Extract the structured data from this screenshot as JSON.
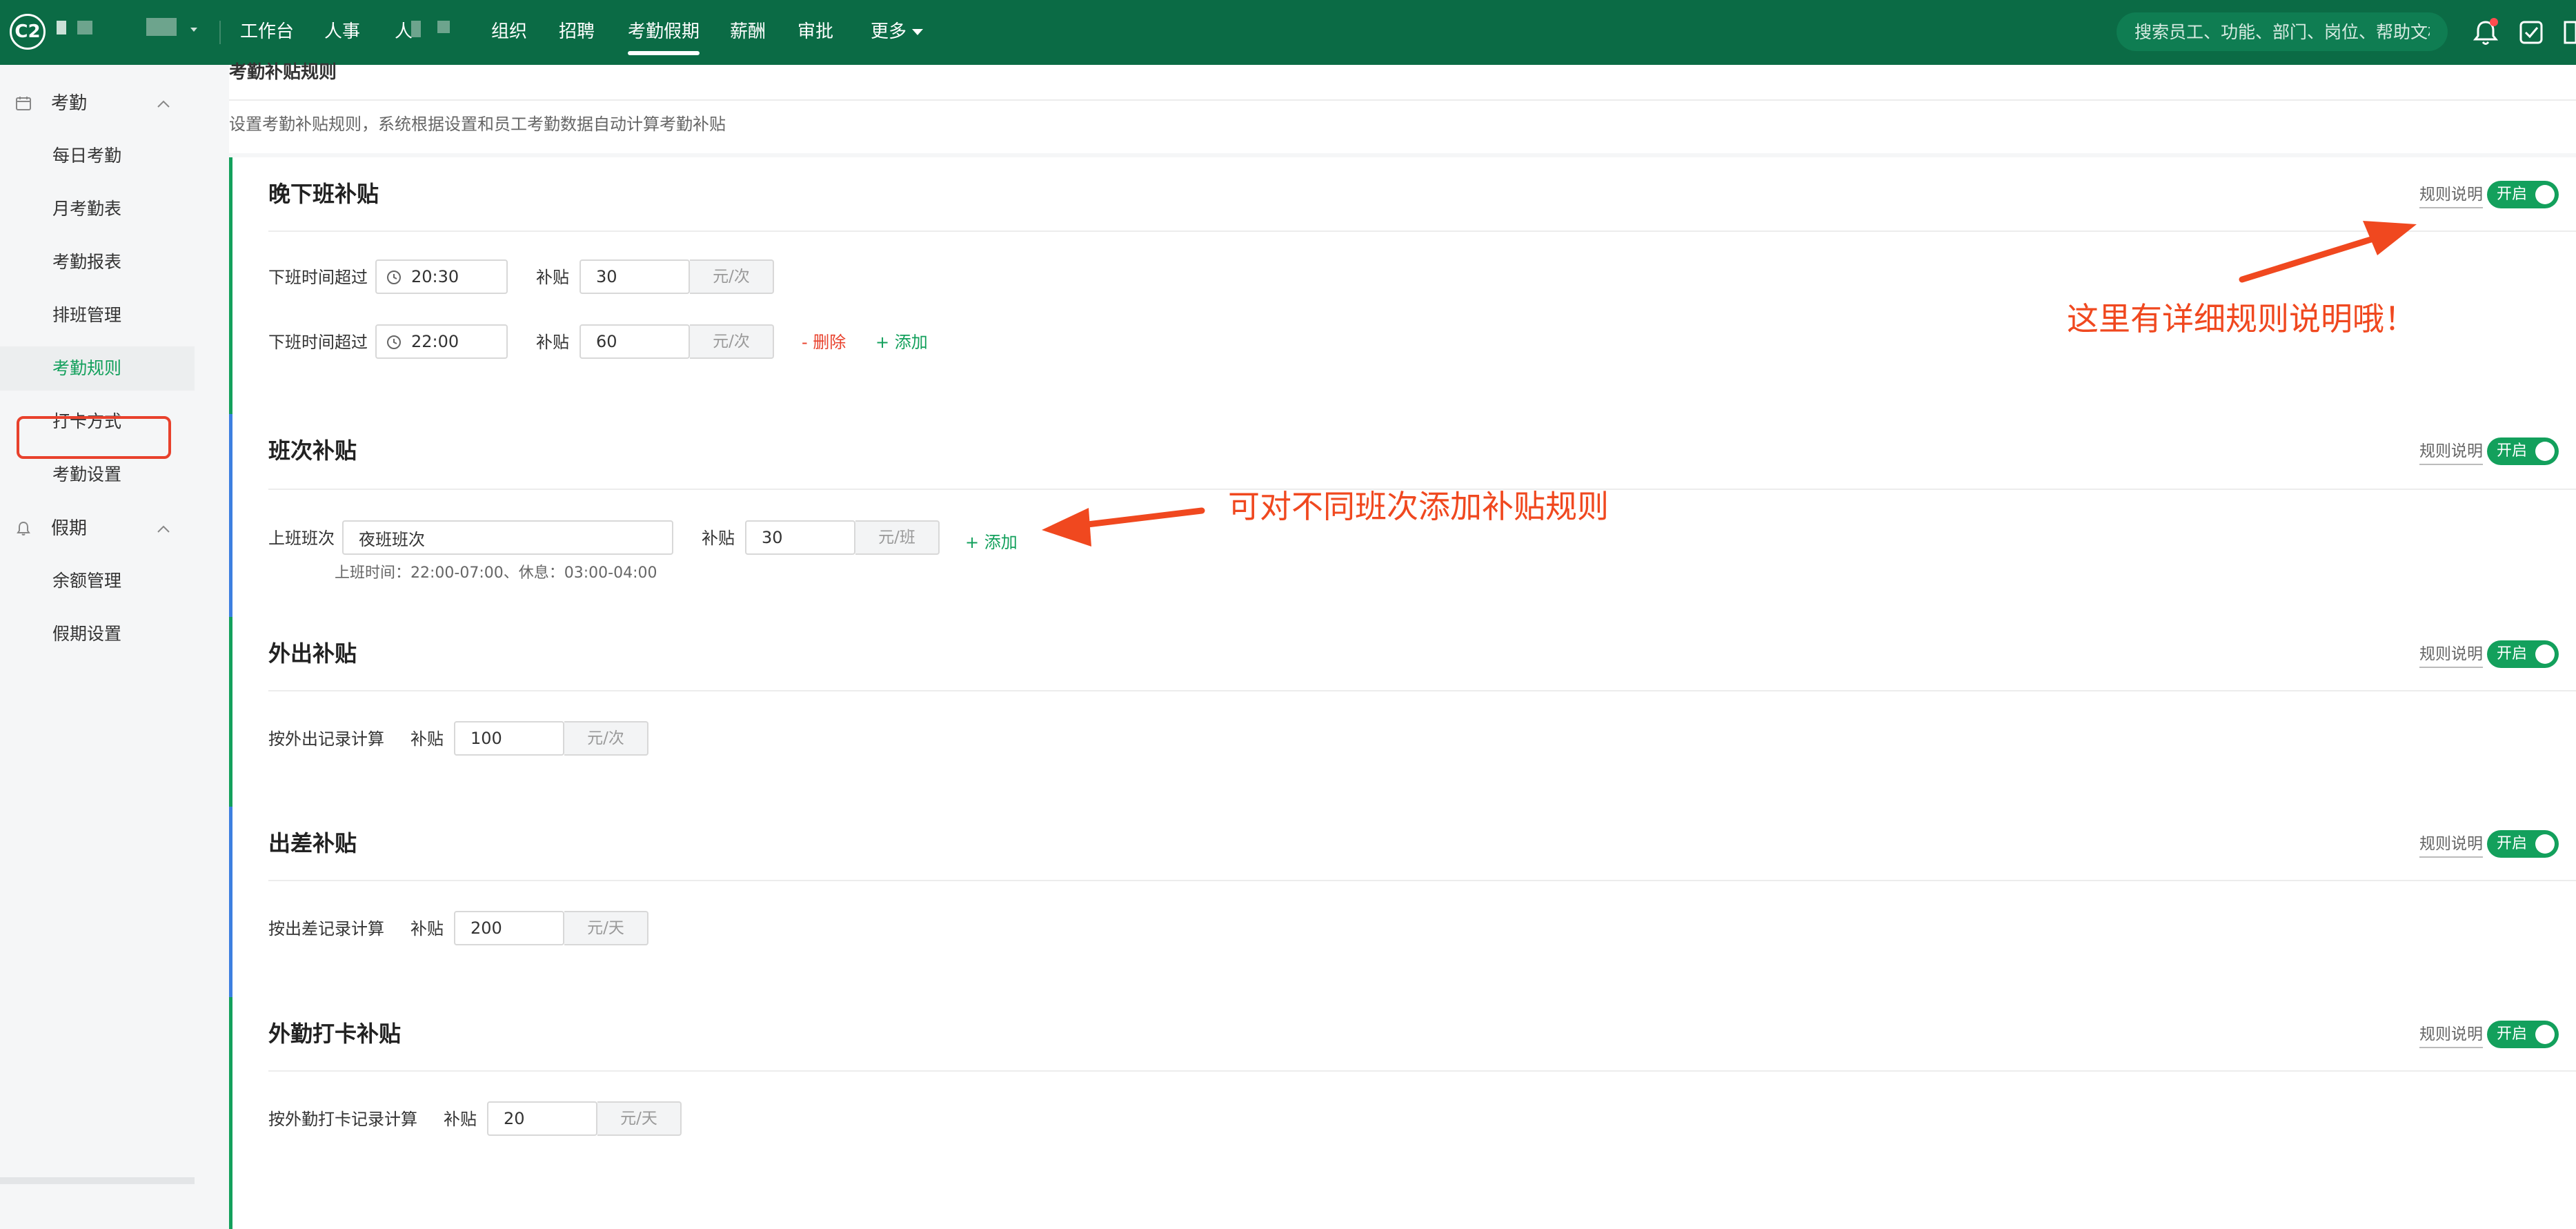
{
  "topbar": {
    "logo_text": "C2",
    "nav": [
      "工作台",
      "人事",
      "人",
      "组织",
      "招聘",
      "考勤假期",
      "薪酬",
      "审批",
      "更多"
    ],
    "active_nav": "考勤假期",
    "search_placeholder": "搜索员工、功能、部门、岗位、帮助文档",
    "notification_badge_color": "#ff4d4f",
    "bg_color": "#0b6b45"
  },
  "sidebar": {
    "groups": [
      {
        "label": "考勤",
        "icon": "calendar-icon",
        "items": [
          "每日考勤",
          "月考勤表",
          "考勤报表",
          "排班管理",
          "考勤规则",
          "打卡方式",
          "考勤设置"
        ]
      },
      {
        "label": "假期",
        "icon": "bell-icon",
        "items": [
          "余额管理",
          "假期设置"
        ]
      }
    ],
    "active_item": "考勤规则"
  },
  "page": {
    "title": "考勤补贴规则",
    "description": "设置考勤补贴规则，系统根据设置和员工考勤数据自动计算考勤补贴"
  },
  "common": {
    "rule_link": "规则说明",
    "toggle_label": "开启",
    "subsidy_label": "补贴",
    "accent_color": "#13a05c"
  },
  "cards": {
    "late_off": {
      "title": "晚下班补贴",
      "rows": [
        {
          "label": "下班时间超过",
          "time": "20:30",
          "amount": "30",
          "unit": "元/次"
        },
        {
          "label": "下班时间超过",
          "time": "22:00",
          "amount": "60",
          "unit": "元/次",
          "delete": "- 删除",
          "add": "+ 添加"
        }
      ]
    },
    "shift": {
      "title": "班次补贴",
      "row_label": "上班班次",
      "shift_value": "夜班班次",
      "amount": "30",
      "unit": "元/班",
      "add": "+ 添加",
      "hint": "上班时间：22:00-07:00、休息：03:00-04:00"
    },
    "outing": {
      "title": "外出补贴",
      "row_label": "按外出记录计算",
      "amount": "100",
      "unit": "元/次"
    },
    "business_trip": {
      "title": "出差补贴",
      "row_label": "按出差记录计算",
      "amount": "200",
      "unit": "元/天"
    },
    "field_punch": {
      "title": "外勤打卡补贴",
      "row_label": "按外勤打卡记录计算",
      "amount": "20",
      "unit": "元/天"
    }
  },
  "annotations": {
    "rule_note": "这里有详细规则说明哦！",
    "shift_note": "可对不同班次添加补贴规则",
    "color": "#f0481f"
  }
}
